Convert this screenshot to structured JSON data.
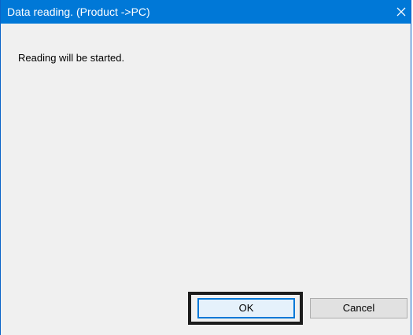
{
  "window": {
    "title": "Data reading. (Product ->PC)",
    "close_icon": "close-icon"
  },
  "dialog": {
    "message": "Reading will be started."
  },
  "buttons": {
    "ok_label": "OK",
    "cancel_label": "Cancel"
  },
  "colors": {
    "titlebar": "#0078d7",
    "dialog_bg": "#f0f0f0",
    "highlight_frame": "#1c1c1c"
  }
}
